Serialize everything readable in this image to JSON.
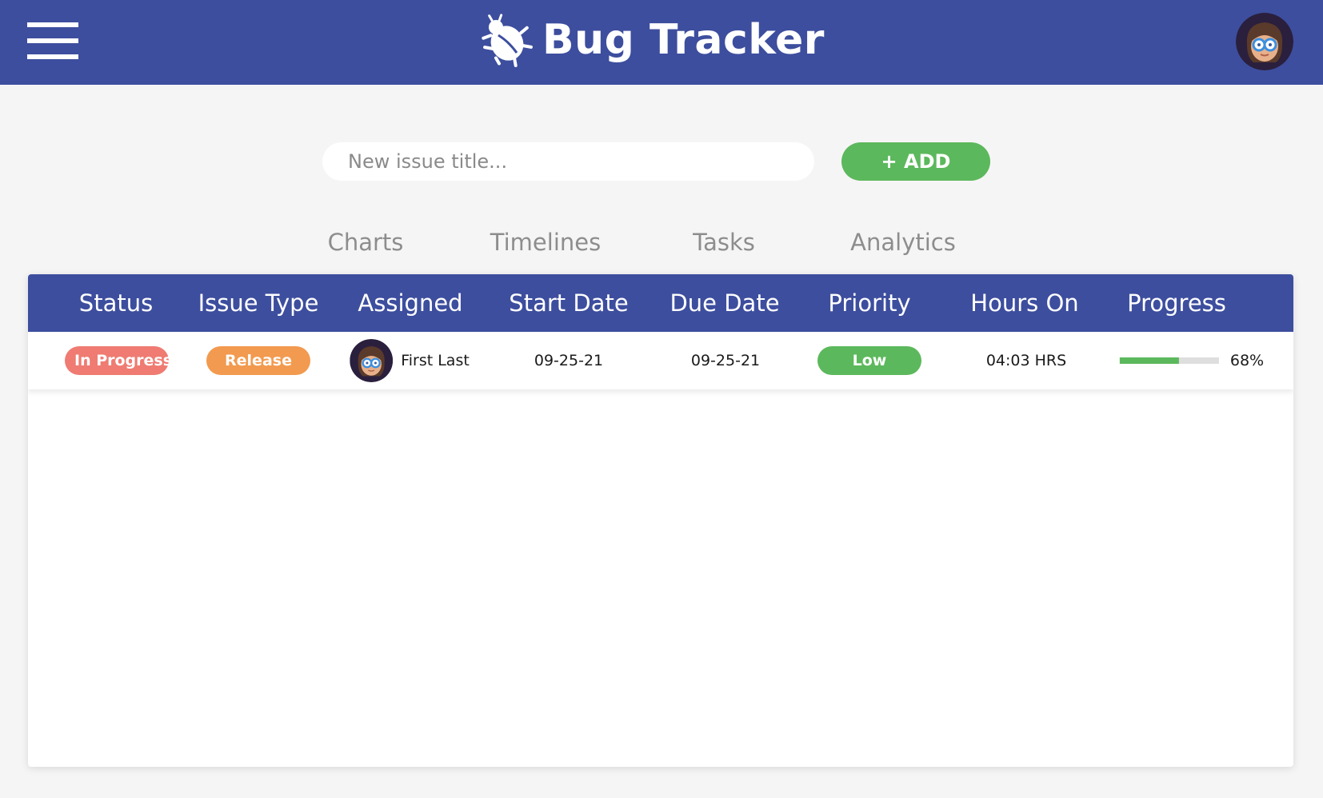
{
  "app": {
    "title": "Bug Tracker"
  },
  "toolbar": {
    "menu_icon": "hamburger-menu-icon",
    "logo_icon": "bug-icon",
    "user_avatar_icon": "user-avatar-glasses"
  },
  "new_issue": {
    "placeholder": "New issue title...",
    "value": "",
    "add_label": "+ ADD"
  },
  "tabs": [
    {
      "label": "Charts"
    },
    {
      "label": "Timelines"
    },
    {
      "label": "Tasks"
    },
    {
      "label": "Analytics"
    }
  ],
  "table": {
    "columns": [
      "Status",
      "Issue Type",
      "Assigned",
      "Start Date",
      "Due Date",
      "Priority",
      "Hours On",
      "Progress"
    ],
    "rows": [
      {
        "status": "In Progress",
        "issue_type": "Release",
        "assigned": "First Last",
        "start_date": "09-25-21",
        "due_date": "09-25-21",
        "priority": "Low",
        "hours_on": "04:03 HRS",
        "progress_label": "68%",
        "progress_fraction": 0.6
      }
    ]
  },
  "colors": {
    "header": "#3d4e9e",
    "accent_green": "#5cb85c",
    "status_in_progress": "#ef7b72",
    "type_release": "#f29a4f",
    "background": "#f6f5f6"
  }
}
